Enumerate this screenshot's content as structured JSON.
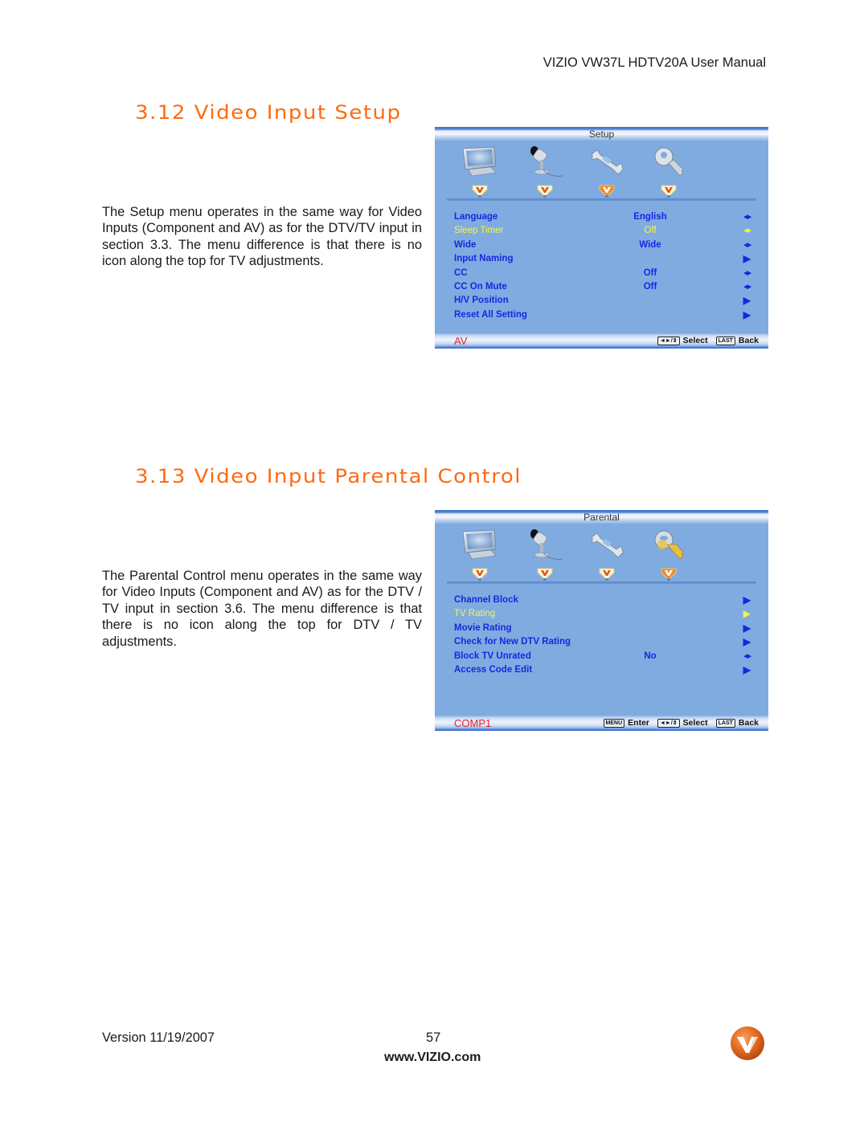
{
  "header": {
    "running_title": "VIZIO VW37L HDTV20A User Manual"
  },
  "sections": [
    {
      "title": "3.12 Video Input Setup",
      "body": "The Setup menu operates in the same way for Video Inputs (Component and AV) as for the DTV/TV input in section 3.3.  The menu difference is that there is no icon along the top for TV adjustments.",
      "osd": {
        "menu_title": "Setup",
        "icons": [
          "monitor-icon",
          "camera-icon",
          "wrench-icon",
          "key-icon"
        ],
        "active_tab_index": 2,
        "rows": [
          {
            "label": "Language",
            "value": "English",
            "arrow": "left-right",
            "selected": false
          },
          {
            "label": "Sleep Timer",
            "value": "Off",
            "arrow": "left-right",
            "selected": true
          },
          {
            "label": "Wide",
            "value": "Wide",
            "arrow": "left-right",
            "selected": false
          },
          {
            "label": "Input Naming",
            "value": "",
            "arrow": "right",
            "selected": false
          },
          {
            "label": "CC",
            "value": "Off",
            "arrow": "left-right",
            "selected": false
          },
          {
            "label": "CC On Mute",
            "value": "Off",
            "arrow": "left-right",
            "selected": false
          },
          {
            "label": "H/V Position",
            "value": "",
            "arrow": "right",
            "selected": false
          },
          {
            "label": "Reset All Setting",
            "value": "",
            "arrow": "right",
            "selected": false
          }
        ],
        "source": "AV",
        "hints": [
          {
            "key": "◄►/⇕",
            "label": "Select"
          },
          {
            "key": "LAST",
            "label": "Back"
          }
        ]
      }
    },
    {
      "title": "3.13 Video Input Parental Control",
      "body": "The Parental Control menu operates in the same way for Video Inputs (Component and AV) as for the DTV / TV input in section 3.6.  The menu difference is that there is no icon along the top for DTV / TV adjustments.",
      "osd": {
        "menu_title": "Parental",
        "icons": [
          "monitor-icon",
          "camera-icon",
          "wrench-icon",
          "key-icon"
        ],
        "active_tab_index": 3,
        "rows": [
          {
            "label": "Channel Block",
            "value": "",
            "arrow": "right",
            "selected": false
          },
          {
            "label": "TV Rating",
            "value": "",
            "arrow": "right",
            "selected": true
          },
          {
            "label": "Movie Rating",
            "value": "",
            "arrow": "right",
            "selected": false
          },
          {
            "label": "Check for New DTV Rating",
            "value": "",
            "arrow": "right",
            "selected": false
          },
          {
            "label": "Block TV Unrated",
            "value": "No",
            "arrow": "left-right",
            "selected": false
          },
          {
            "label": "Access Code Edit",
            "value": "",
            "arrow": "right",
            "selected": false
          }
        ],
        "source": "COMP1",
        "hints": [
          {
            "key": "MENU",
            "label": "Enter"
          },
          {
            "key": "◄►/⇕",
            "label": "Select"
          },
          {
            "key": "LAST",
            "label": "Back"
          }
        ]
      }
    }
  ],
  "footer": {
    "version": "Version 11/19/2007",
    "page_number": "57",
    "url": "www.VIZIO.com",
    "logo": "vizio-v-logo"
  },
  "colors": {
    "heading": "#ff6a10",
    "osd_background": "#80abe0",
    "osd_text": "#1826e0",
    "osd_selected": "#f5f54a",
    "osd_source": "#e8242a"
  }
}
